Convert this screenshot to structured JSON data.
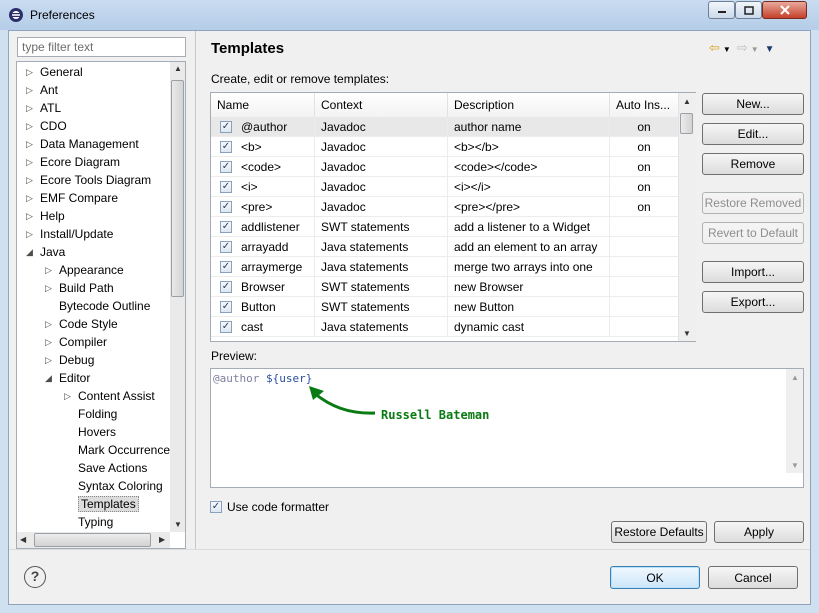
{
  "window": {
    "title": "Preferences"
  },
  "filter": {
    "placeholder": "type filter text"
  },
  "tree": [
    {
      "label": "General",
      "level": 0,
      "twisty": "▷"
    },
    {
      "label": "Ant",
      "level": 0,
      "twisty": "▷"
    },
    {
      "label": "ATL",
      "level": 0,
      "twisty": "▷"
    },
    {
      "label": "CDO",
      "level": 0,
      "twisty": "▷"
    },
    {
      "label": "Data Management",
      "level": 0,
      "twisty": "▷"
    },
    {
      "label": "Ecore Diagram",
      "level": 0,
      "twisty": "▷"
    },
    {
      "label": "Ecore Tools Diagram",
      "level": 0,
      "twisty": "▷"
    },
    {
      "label": "EMF Compare",
      "level": 0,
      "twisty": "▷"
    },
    {
      "label": "Help",
      "level": 0,
      "twisty": "▷"
    },
    {
      "label": "Install/Update",
      "level": 0,
      "twisty": "▷"
    },
    {
      "label": "Java",
      "level": 0,
      "twisty": "◢"
    },
    {
      "label": "Appearance",
      "level": 1,
      "twisty": "▷"
    },
    {
      "label": "Build Path",
      "level": 1,
      "twisty": "▷"
    },
    {
      "label": "Bytecode Outline",
      "level": 1,
      "twisty": ""
    },
    {
      "label": "Code Style",
      "level": 1,
      "twisty": "▷"
    },
    {
      "label": "Compiler",
      "level": 1,
      "twisty": "▷"
    },
    {
      "label": "Debug",
      "level": 1,
      "twisty": "▷"
    },
    {
      "label": "Editor",
      "level": 1,
      "twisty": "◢"
    },
    {
      "label": "Content Assist",
      "level": 2,
      "twisty": "▷"
    },
    {
      "label": "Folding",
      "level": 2,
      "twisty": ""
    },
    {
      "label": "Hovers",
      "level": 2,
      "twisty": ""
    },
    {
      "label": "Mark Occurrences",
      "level": 2,
      "twisty": ""
    },
    {
      "label": "Save Actions",
      "level": 2,
      "twisty": ""
    },
    {
      "label": "Syntax Coloring",
      "level": 2,
      "twisty": ""
    },
    {
      "label": "Templates",
      "level": 2,
      "twisty": "",
      "selected": true
    },
    {
      "label": "Typing",
      "level": 2,
      "twisty": ""
    }
  ],
  "page": {
    "title": "Templates",
    "description": "Create, edit or remove templates:"
  },
  "table": {
    "columns": [
      "Name",
      "Context",
      "Description",
      "Auto Ins..."
    ],
    "rows": [
      {
        "name": "@author",
        "context": "Javadoc",
        "description": "author name",
        "auto": "on",
        "checked": true
      },
      {
        "name": "<b>",
        "context": "Javadoc",
        "description": "<b></b>",
        "auto": "on",
        "checked": true
      },
      {
        "name": "<code>",
        "context": "Javadoc",
        "description": "<code></code>",
        "auto": "on",
        "checked": true
      },
      {
        "name": "<i>",
        "context": "Javadoc",
        "description": "<i></i>",
        "auto": "on",
        "checked": true
      },
      {
        "name": "<pre>",
        "context": "Javadoc",
        "description": "<pre></pre>",
        "auto": "on",
        "checked": true
      },
      {
        "name": "addlistener",
        "context": "SWT statements",
        "description": "add a listener to a Widget",
        "auto": "",
        "checked": true
      },
      {
        "name": "arrayadd",
        "context": "Java statements",
        "description": "add an element to an array",
        "auto": "",
        "checked": true
      },
      {
        "name": "arraymerge",
        "context": "Java statements",
        "description": "merge two arrays into one",
        "auto": "",
        "checked": true
      },
      {
        "name": "Browser",
        "context": "SWT statements",
        "description": "new Browser",
        "auto": "",
        "checked": true
      },
      {
        "name": "Button",
        "context": "SWT statements",
        "description": "new Button",
        "auto": "",
        "checked": true
      },
      {
        "name": "cast",
        "context": "Java statements",
        "description": "dynamic cast",
        "auto": "",
        "checked": true
      }
    ]
  },
  "side_buttons": {
    "new": "New...",
    "edit": "Edit...",
    "remove": "Remove",
    "restore_removed": "Restore Removed",
    "revert_default": "Revert to Default",
    "import": "Import...",
    "export": "Export..."
  },
  "preview": {
    "label": "Preview:",
    "code_tag": "@author ",
    "code_var": "${user}",
    "annotation": "Russell Bateman"
  },
  "use_code_formatter": {
    "label": "Use code formatter",
    "checked": true
  },
  "buttons": {
    "restore_defaults": "Restore Defaults",
    "apply": "Apply",
    "ok": "OK",
    "cancel": "Cancel",
    "help": "?"
  },
  "colors": {
    "annotation": "#0a7a12",
    "ok_border": "#3c7fb1"
  }
}
